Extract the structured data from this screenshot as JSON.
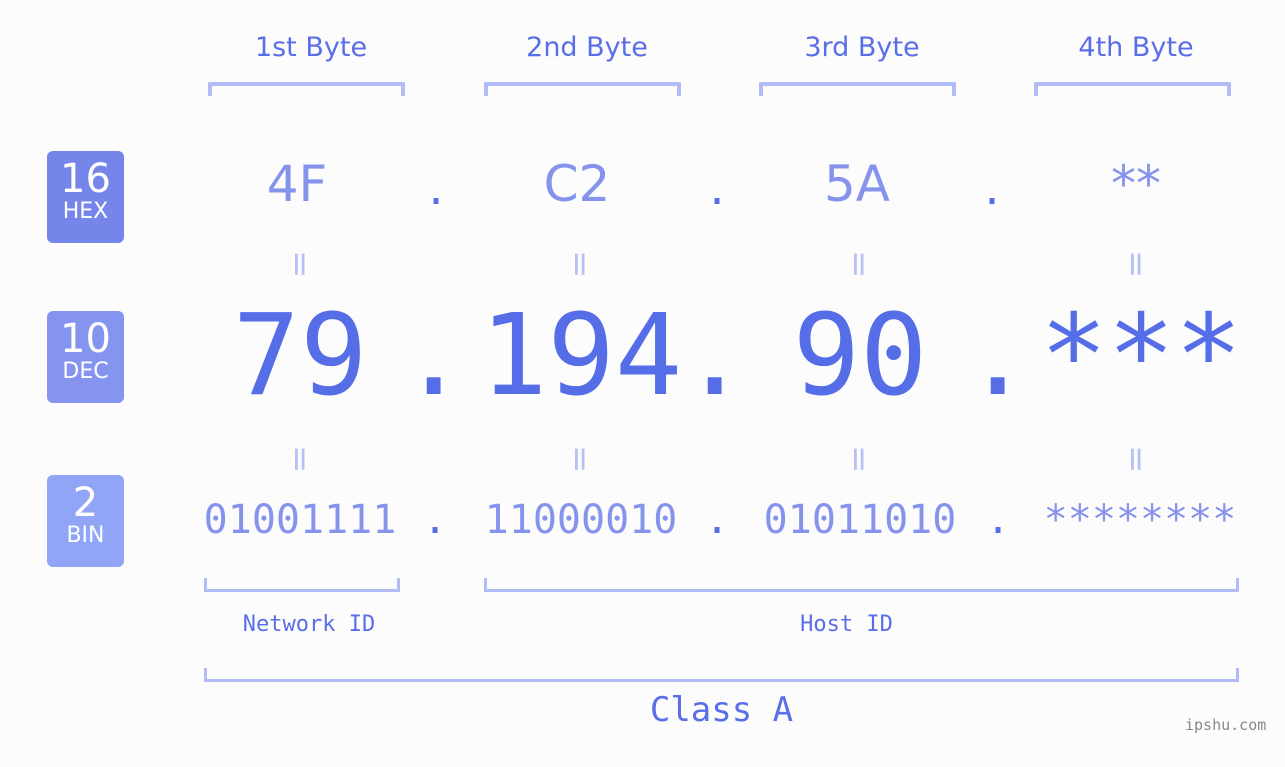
{
  "bytes": {
    "headers": [
      "1st Byte",
      "2nd Byte",
      "3rd Byte",
      "4th Byte"
    ],
    "hex": [
      "4F",
      "C2",
      "5A",
      "**"
    ],
    "dec": [
      "79",
      "194",
      "90",
      "***"
    ],
    "bin": [
      "01001111",
      "11000010",
      "01011010",
      "********"
    ],
    "separator": ".",
    "equals": "="
  },
  "badges": {
    "hex": {
      "num": "16",
      "label": "HEX",
      "color": "#7585ea"
    },
    "dec": {
      "num": "10",
      "label": "DEC",
      "color": "#8595ef"
    },
    "bin": {
      "num": "2",
      "label": "BIN",
      "color": "#90a5f6"
    }
  },
  "segments": {
    "network": "Network ID",
    "host": "Host ID",
    "class": "Class A"
  },
  "watermark": "ipshu.com",
  "colors": {
    "accent": "#566de8",
    "light": "#8593ed",
    "bracket": "#b1bbf6"
  }
}
